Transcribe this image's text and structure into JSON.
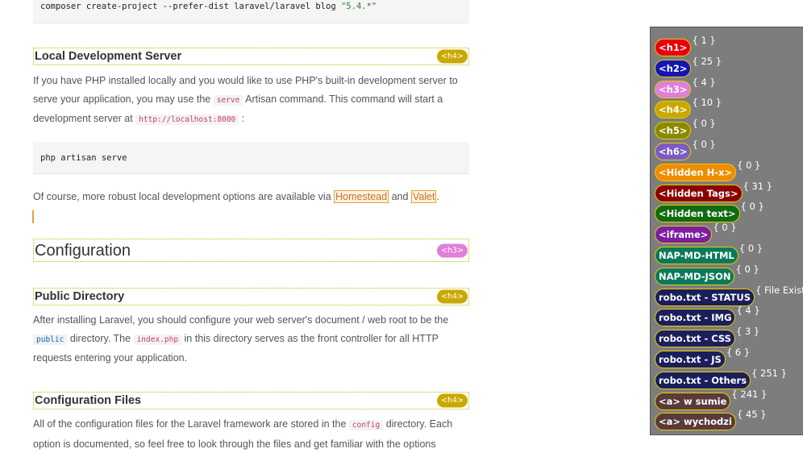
{
  "doc": {
    "code_install": {
      "cmd": "composer create-project --prefer-dist laravel/laravel blog ",
      "str": "\"5.4.*\""
    },
    "h_local_server": "Local Development Server",
    "p_local_1": "If you have PHP installed locally and you would like to use PHP's built-in development server to",
    "p_local_2a": "serve your application, you may use the",
    "p_local_2_code": "serve",
    "p_local_2b": "Artisan command. This command will start a",
    "p_local_3a": "development server at",
    "p_local_3_code": "http://localhost:8000",
    "p_local_3b": ":",
    "code_serve": "php artisan serve",
    "p_robust_a": "Of course, more robust local development options are available via",
    "link_homestead": "Homestead",
    "p_robust_and": "and",
    "link_valet": "Valet",
    "p_robust_end": ".",
    "h_configuration": "Configuration",
    "h_public_dir": "Public Directory",
    "p_public_1": "After installing Laravel, you should configure your web server's document / web root to be the",
    "p_public_2_code1": "public",
    "p_public_2a": "directory. The",
    "p_public_2_code2": "index.php",
    "p_public_2b": "in this directory serves as the front controller for all HTTP",
    "p_public_3": "requests entering your application.",
    "h_config_files": "Configuration Files",
    "p_config_1a": "All of the configuration files for the Laravel framework are stored in the",
    "p_config_1_code": "config",
    "p_config_1b": "directory. Each",
    "p_config_2": "option is documented, so feel free to look through the files and get familiar with the options",
    "tag_h4": "<h4>",
    "tag_h3": "<h3>"
  },
  "panel": {
    "rows": [
      {
        "label": "<h1>",
        "count": "{ 1 }",
        "color": "#e8000c"
      },
      {
        "label": "<h2>",
        "count": "{ 25 }",
        "color": "#1515b5"
      },
      {
        "label": "<h3>",
        "count": "{ 4 }",
        "color": "#e07fd8"
      },
      {
        "label": "<h4>",
        "count": "{ 10 }",
        "color": "#c9a800"
      },
      {
        "label": "<h5>",
        "count": "{ 0 }",
        "color": "#8a8a00"
      },
      {
        "label": "<h6>",
        "count": "{ 0 }",
        "color": "#7b5cc0"
      },
      {
        "label": "<Hidden H-x>",
        "count": "{ 0 }",
        "color": "#ef8c00"
      },
      {
        "label": "<Hidden Tags>",
        "count": "{ 31 }",
        "color": "#8b0000"
      },
      {
        "label": "<Hidden text>",
        "count": "{ 0 }",
        "color": "#0f6b0f"
      },
      {
        "label": "<iframe>",
        "count": "{ 0 }",
        "color": "#7b1fa2"
      },
      {
        "label": "NAP-MD-HTML",
        "count": "{ 0 }",
        "color": "#0a7a5a"
      },
      {
        "label": "NAP-MD-JSON",
        "count": "{ 0 }",
        "color": "#0a7a5a"
      },
      {
        "label": "robo.txt - STATUS",
        "count": "{ File Exists }",
        "color": "#1a1f5c"
      },
      {
        "label": "robo.txt - IMG",
        "count": "{ 4 }",
        "color": "#1a1f5c"
      },
      {
        "label": "robo.txt - CSS",
        "count": "{ 3 }",
        "color": "#1a1f5c"
      },
      {
        "label": "robo.txt - JS",
        "count": "{ 6 }",
        "color": "#1a1f5c"
      },
      {
        "label": "robo.txt - Others",
        "count": "{ 251 }",
        "color": "#1a1f5c"
      },
      {
        "label": "<a> w sumie",
        "count": "{ 241 }",
        "color": "#5a3a3a"
      },
      {
        "label": "<a> wychodzi",
        "count": "{ 45 }",
        "color": "#5a3a3a"
      }
    ]
  }
}
